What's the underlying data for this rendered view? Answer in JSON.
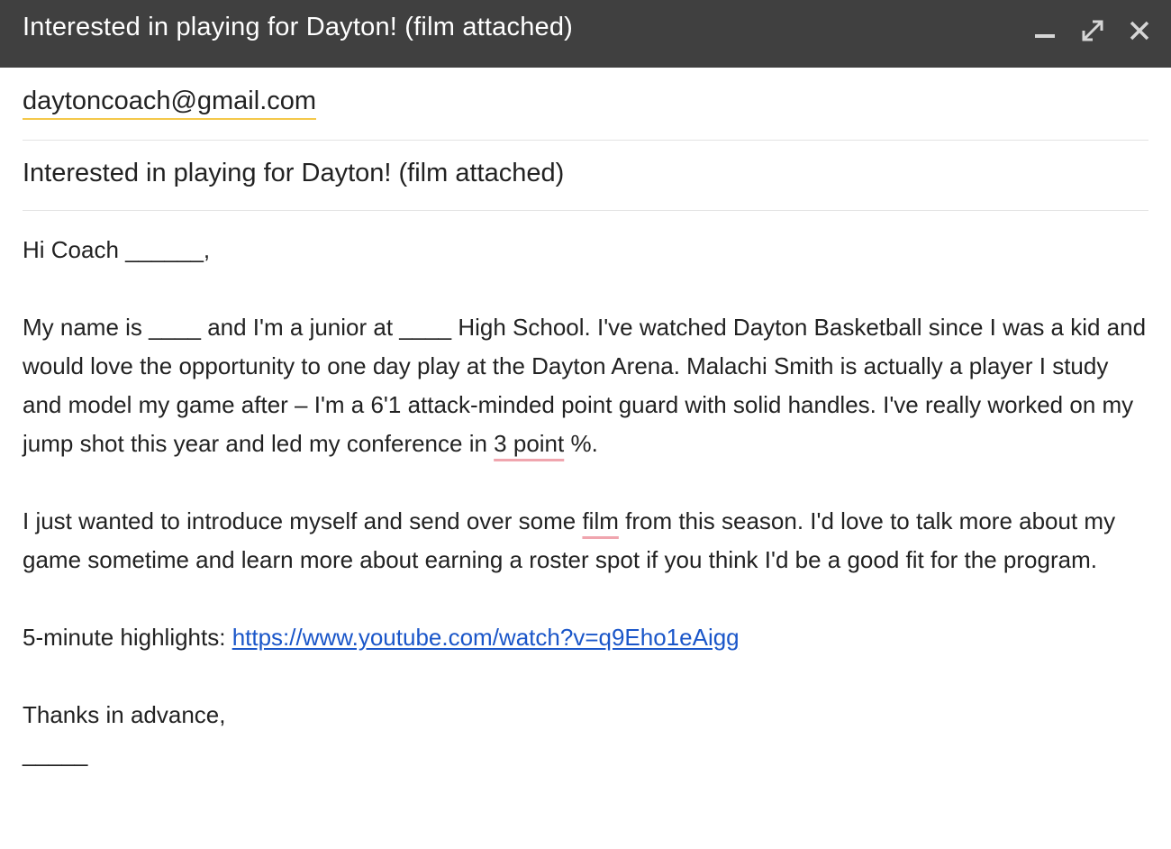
{
  "window": {
    "title": "Interested in playing for Dayton! (film attached)",
    "controls": {
      "minimize_icon": "minimize-icon",
      "expand_icon": "expand-icon",
      "close_icon": "close-icon"
    }
  },
  "to": {
    "recipient": "daytoncoach@gmail.com"
  },
  "subject": {
    "value": "Interested in playing for Dayton! (film attached)"
  },
  "body": {
    "greeting": "Hi Coach ______,",
    "p1_a": "My name is ____ and I'm a junior at ____ High School. I've watched Dayton Basketball since I was a kid and would love the opportunity to one day play at the Dayton Arena. Malachi Smith is actually a player I study and model my game after – I'm a 6'1 attack-minded point guard with solid handles. I've really worked on my jump shot this year and led my conference in ",
    "p1_flag": "3 point",
    "p1_b": " %.",
    "p2_a": "I just wanted to introduce myself and send over some ",
    "p2_flag": "film",
    "p2_b": " from this season. I'd love to talk more about my game sometime and learn more about earning a roster spot if you think I'd be a good fit for the program.",
    "highlights_label": "5-minute highlights: ",
    "highlights_link": "https://www.youtube.com/watch?v=q9Eho1eAigg",
    "closing": "Thanks in advance,",
    "signature": "_____"
  },
  "colors": {
    "titlebar": "#404040",
    "recipient_underline": "#f4c84a",
    "spellcheck": "#f0a5ae",
    "link": "#1a56c9"
  }
}
